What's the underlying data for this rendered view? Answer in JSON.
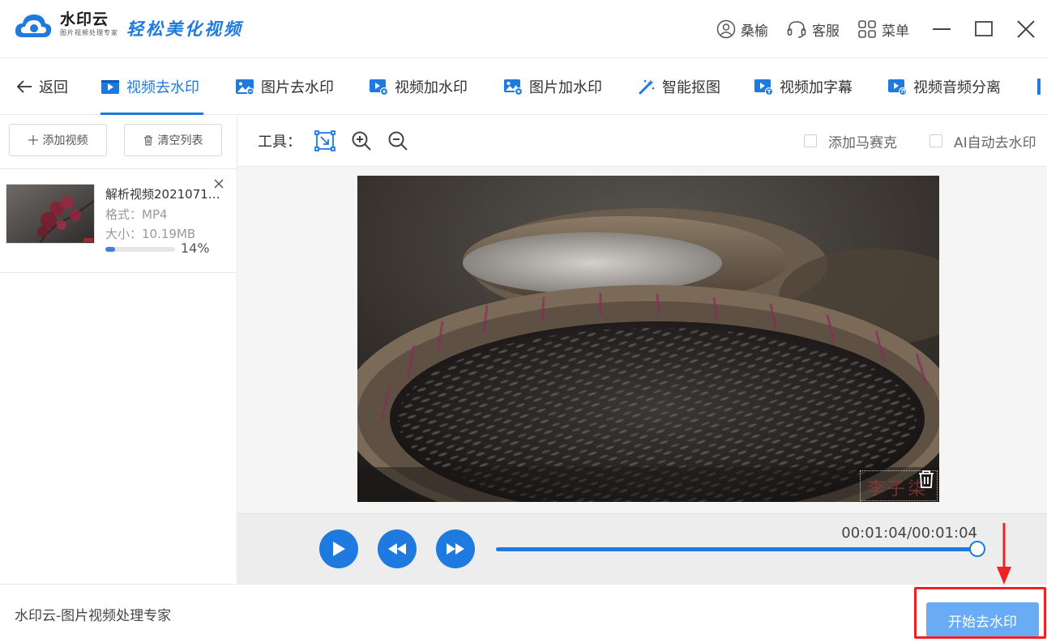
{
  "titlebar": {
    "brand_name": "水印云",
    "brand_sub": "图片视频处理专家",
    "slogan": "轻松美化视频",
    "user_label": "桑榆",
    "service_label": "客服",
    "menu_label": "菜单"
  },
  "nav": {
    "back_label": "返回",
    "tabs": [
      {
        "label": "视频去水印",
        "icon": "video-icon"
      },
      {
        "label": "图片去水印",
        "icon": "image-icon"
      },
      {
        "label": "视频加水印",
        "icon": "video-add-icon"
      },
      {
        "label": "图片加水印",
        "icon": "image-add-icon"
      },
      {
        "label": "智能抠图",
        "icon": "magic-wand-icon"
      },
      {
        "label": "视频加字幕",
        "icon": "video-subtitle-icon"
      },
      {
        "label": "视频音频分离",
        "icon": "video-audio-icon"
      }
    ],
    "active_tab": 0
  },
  "sidebar": {
    "add_video_label": "添加视频",
    "clear_list_label": "清空列表",
    "files": [
      {
        "name": "解析视频2021071…",
        "format": "格式：MP4",
        "size": "大小：10.19MB",
        "progress_percent": 14,
        "progress_label": "14%"
      }
    ]
  },
  "toolbar": {
    "label": "工具：",
    "mosaic_label": "添加马赛克",
    "ai_remove_label": "AI自动去水印"
  },
  "preview": {
    "watermark_text": "李子柒"
  },
  "player": {
    "timecode": "00:01:04/00:01:04",
    "seek_fraction": 1.0
  },
  "footer": {
    "app_text": "水印云-图片视频处理专家",
    "start_label": "开始去水印"
  },
  "colors": {
    "accent": "#1f7ae0",
    "start_button": "#6aabf5",
    "highlight_red": "#ee2222"
  }
}
